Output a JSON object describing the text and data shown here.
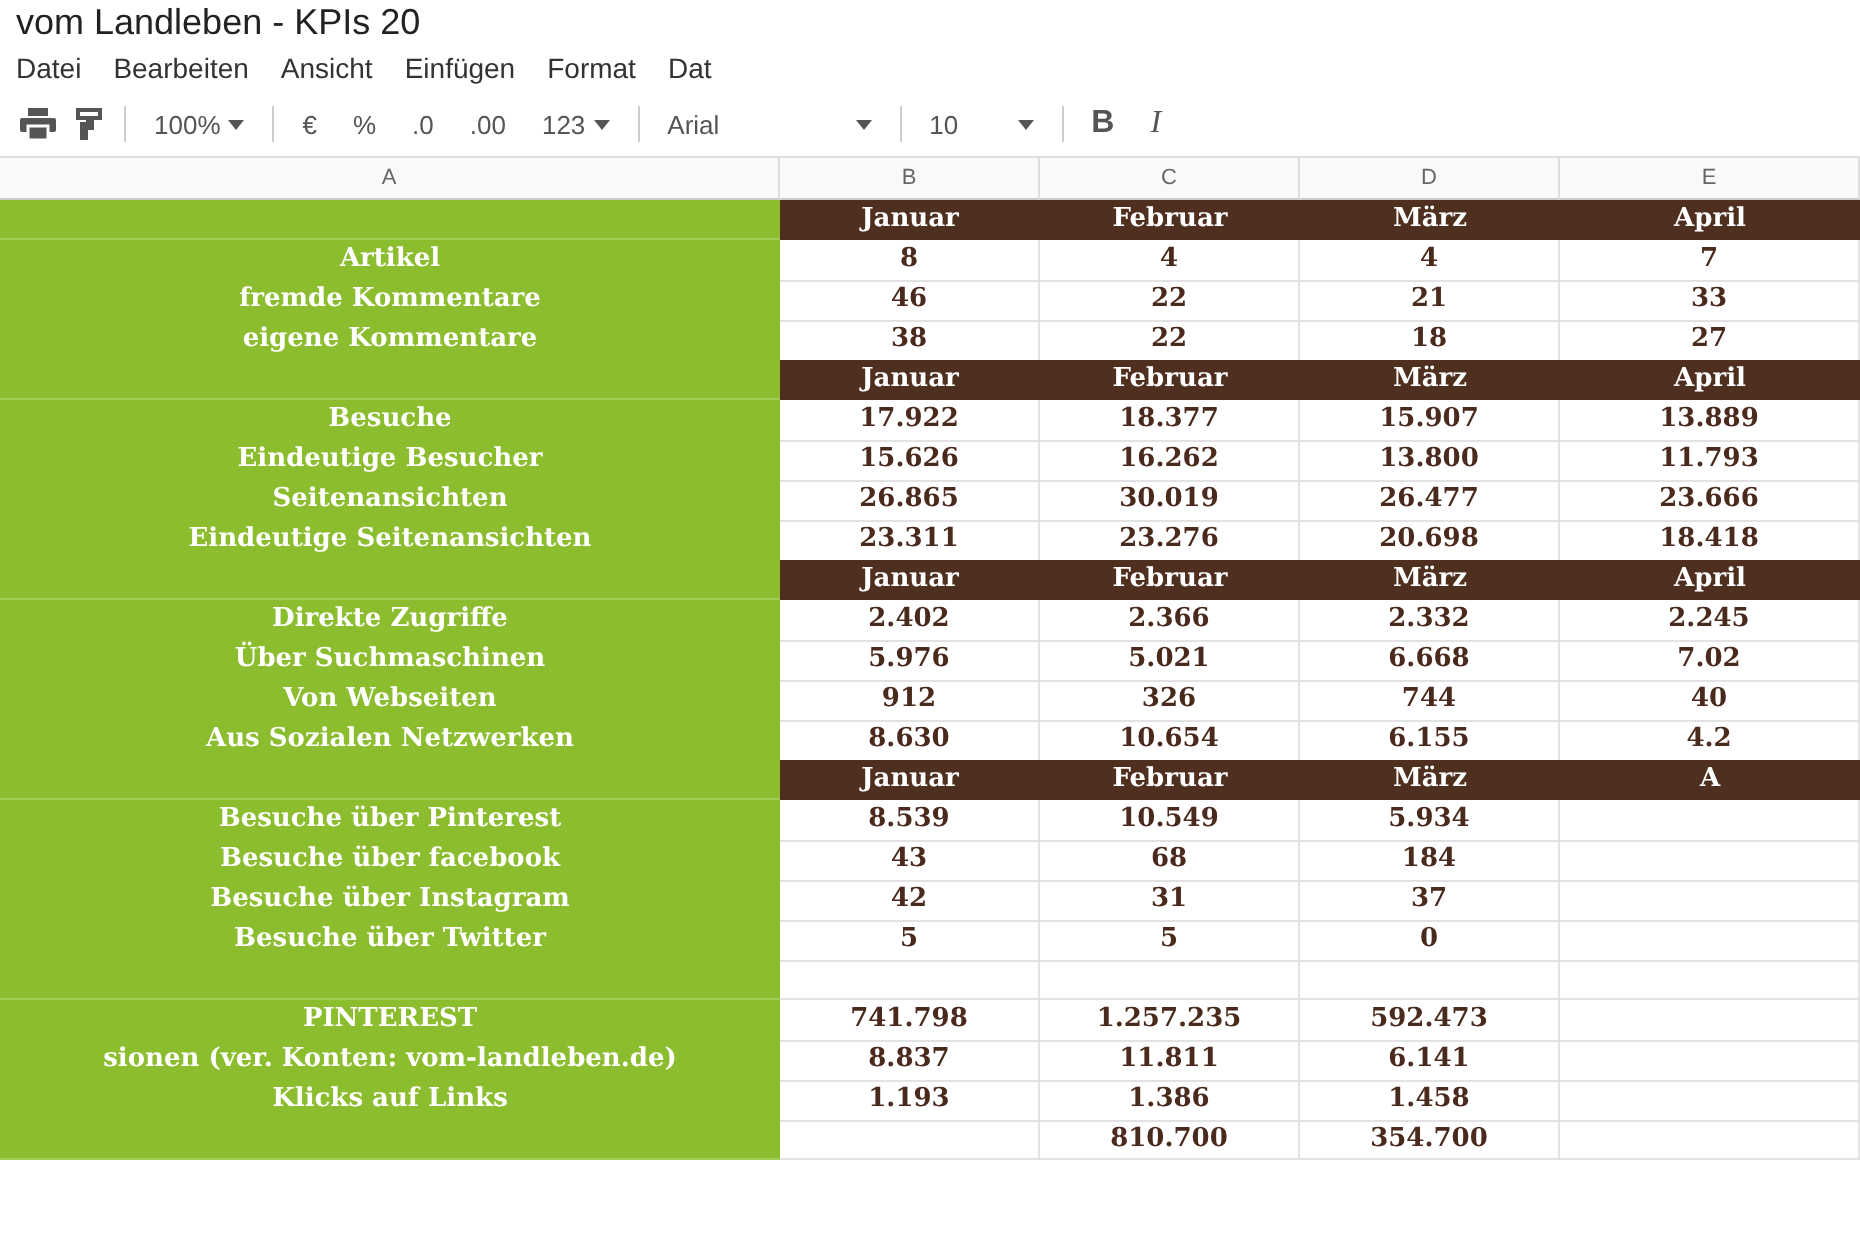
{
  "window": {
    "title": "vom Landleben - KPIs 20"
  },
  "menu": [
    "Datei",
    "Bearbeiten",
    "Ansicht",
    "Einfügen",
    "Format",
    "Dat"
  ],
  "toolbar": {
    "zoom": "100%",
    "currency": "€",
    "percent": "%",
    "decrease_decimals": ".0",
    "increase_decimals": ".00",
    "number_format": "123",
    "font": "Arial",
    "font_size": "10",
    "bold": "B",
    "italic": "I"
  },
  "column_headers": [
    "A",
    "B",
    "C",
    "D",
    "E"
  ],
  "sections": [
    {
      "months": [
        "Januar",
        "Februar",
        "März",
        "April"
      ],
      "rows": [
        {
          "label": "Artikel",
          "values": {
            "B": "8",
            "C": "4",
            "D": "4",
            "E": "7"
          }
        },
        {
          "label": "fremde Kommentare",
          "values": {
            "B": "46",
            "C": "22",
            "D": "21",
            "E": "33"
          }
        },
        {
          "label": "eigene Kommentare",
          "values": {
            "B": "38",
            "C": "22",
            "D": "18",
            "E": "27"
          }
        }
      ]
    },
    {
      "months": [
        "Januar",
        "Februar",
        "März",
        "April"
      ],
      "rows": [
        {
          "label": "Besuche",
          "values": {
            "B": "17.922",
            "C": "18.377",
            "D": "15.907",
            "E": "13.889"
          }
        },
        {
          "label": "Eindeutige Besucher",
          "values": {
            "B": "15.626",
            "C": "16.262",
            "D": "13.800",
            "E": "11.793"
          }
        },
        {
          "label": "Seitenansichten",
          "values": {
            "B": "26.865",
            "C": "30.019",
            "D": "26.477",
            "E": "23.666"
          }
        },
        {
          "label": "Eindeutige Seitenansichten",
          "values": {
            "B": "23.311",
            "C": "23.276",
            "D": "20.698",
            "E": "18.418"
          }
        }
      ]
    },
    {
      "months": [
        "Januar",
        "Februar",
        "März",
        "April"
      ],
      "rows": [
        {
          "label": "Direkte Zugriffe",
          "values": {
            "B": "2.402",
            "C": "2.366",
            "D": "2.332",
            "E": "2.245"
          }
        },
        {
          "label": "Über Suchmaschinen",
          "values": {
            "B": "5.976",
            "C": "5.021",
            "D": "6.668",
            "E": "7.02"
          }
        },
        {
          "label": "Von Webseiten",
          "values": {
            "B": "912",
            "C": "326",
            "D": "744",
            "E": "40"
          }
        },
        {
          "label": "Aus Sozialen Netzwerken",
          "values": {
            "B": "8.630",
            "C": "10.654",
            "D": "6.155",
            "E": "4.2"
          }
        }
      ]
    },
    {
      "months": [
        "Januar",
        "Februar",
        "März",
        "A"
      ],
      "rows": [
        {
          "label": "Besuche über Pinterest",
          "values": {
            "B": "8.539",
            "C": "10.549",
            "D": "5.934"
          }
        },
        {
          "label": "Besuche über facebook",
          "values": {
            "B": "43",
            "C": "68",
            "D": "184"
          }
        },
        {
          "label": "Besuche über Instagram",
          "values": {
            "B": "42",
            "C": "31",
            "D": "37"
          }
        },
        {
          "label": "Besuche über Twitter",
          "values": {
            "B": "5",
            "C": "5",
            "D": "0"
          }
        }
      ]
    },
    {
      "rows": [
        {
          "label": "PINTEREST",
          "values": {
            "B": "741.798",
            "C": "1.257.235",
            "D": "592.473"
          }
        },
        {
          "label": "sionen (ver. Konten: vom-landleben.de)",
          "values": {
            "B": "8.837",
            "C": "11.811",
            "D": "6.141"
          }
        },
        {
          "label": "Klicks auf Links",
          "values": {
            "B": "1.193",
            "C": "1.386",
            "D": "1.458"
          }
        },
        {
          "values": {
            "C": "810.700",
            "D": "354.700"
          }
        }
      ]
    }
  ]
}
